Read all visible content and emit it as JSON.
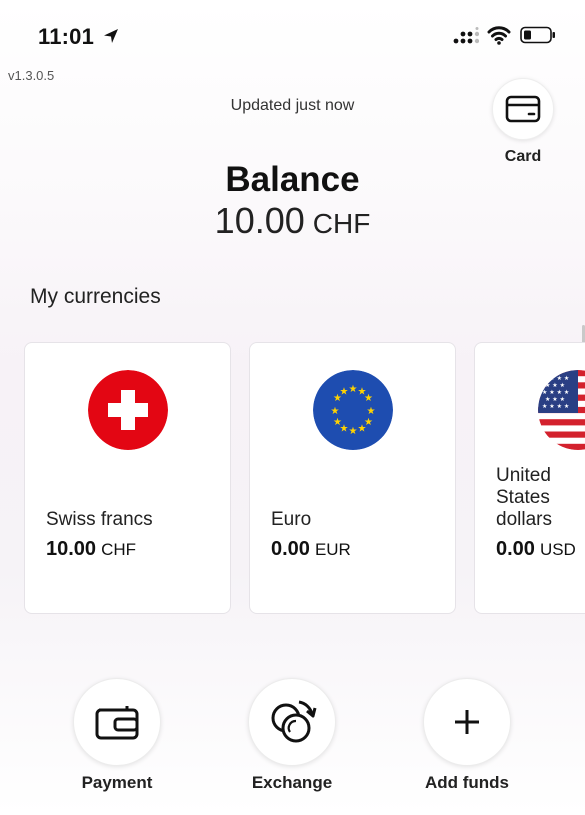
{
  "status_bar": {
    "time": "11:01"
  },
  "version": "v1.3.0.5",
  "updated_text": "Updated just now",
  "card_button": {
    "label": "Card"
  },
  "balance": {
    "title": "Balance",
    "amount": "10.00",
    "currency": "CHF"
  },
  "currencies_title": "My currencies",
  "currencies": [
    {
      "name": "Swiss francs",
      "amount": "10.00",
      "code": "CHF",
      "flag": "swiss-flag-icon"
    },
    {
      "name": "Euro",
      "amount": "0.00",
      "code": "EUR",
      "flag": "eu-flag-icon"
    },
    {
      "name": "United States\ndollars",
      "amount": "0.00",
      "code": "USD",
      "flag": "us-flag-icon"
    }
  ],
  "actions": [
    {
      "label": "Payment",
      "icon": "wallet-icon"
    },
    {
      "label": "Exchange",
      "icon": "exchange-coins-icon"
    },
    {
      "label": "Add funds",
      "icon": "plus-icon"
    }
  ],
  "colors": {
    "swiss_red": "#e30613",
    "eu_blue": "#1e4db0",
    "eu_star": "#ffd200",
    "us_red": "#d3212d",
    "us_blue": "#2a3f84"
  }
}
